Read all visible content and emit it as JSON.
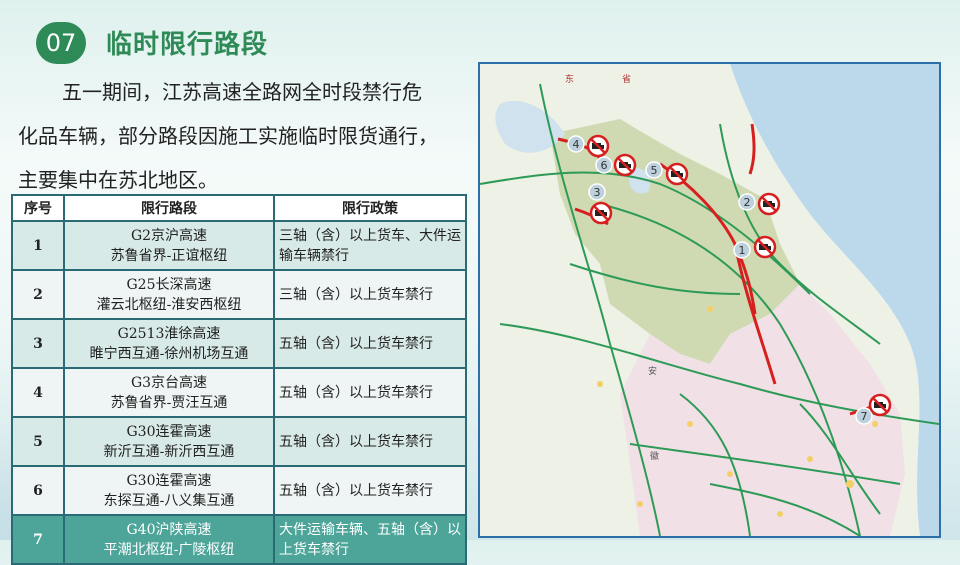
{
  "section": {
    "number": "07",
    "title": "临时限行路段"
  },
  "intro": {
    "line1": "五一期间，江苏高速全路网全时段禁行危",
    "line2": "化品车辆，部分路段因施工实施临时限货通行，",
    "line3": "主要集中在苏北地区。"
  },
  "table": {
    "headers": [
      "序号",
      "限行路段",
      "限行政策"
    ],
    "rows": [
      {
        "no": "1",
        "road": "G2京沪高速",
        "segment": "苏鲁省界-正谊枢纽",
        "policy": "三轴（含）以上货车、大件运输车辆禁行"
      },
      {
        "no": "2",
        "road": "G25长深高速",
        "segment": "灌云北枢纽-淮安西枢纽",
        "policy": "三轴（含）以上货车禁行"
      },
      {
        "no": "3",
        "road": "G2513淮徐高速",
        "segment": "睢宁西互通-徐州机场互通",
        "policy": "五轴（含）以上货车禁行"
      },
      {
        "no": "4",
        "road": "G3京台高速",
        "segment": "苏鲁省界-贾汪互通",
        "policy": "五轴（含）以上货车禁行"
      },
      {
        "no": "5",
        "road": "G30连霍高速",
        "segment": "新沂互通-新沂西互通",
        "policy": "五轴（含）以上货车禁行"
      },
      {
        "no": "6",
        "road": "G30连霍高速",
        "segment": "东探互通-八义集互通",
        "policy": "五轴（含）以上货车禁行"
      },
      {
        "no": "7",
        "road": "G40沪陕高速",
        "segment": "平潮北枢纽-广陵枢纽",
        "policy": "大件运输车辆、五轴（含）以上货车禁行"
      }
    ]
  },
  "map": {
    "markers": [
      "1",
      "2",
      "3",
      "4",
      "5",
      "6",
      "7"
    ],
    "labels": [
      "东",
      "省",
      "徽",
      "安"
    ],
    "colors": {
      "restricted_road": "#d62020",
      "highway": "#2e9a57",
      "sea": "#bcd9ec",
      "jiangsu_north": "#c9d6a8"
    }
  }
}
